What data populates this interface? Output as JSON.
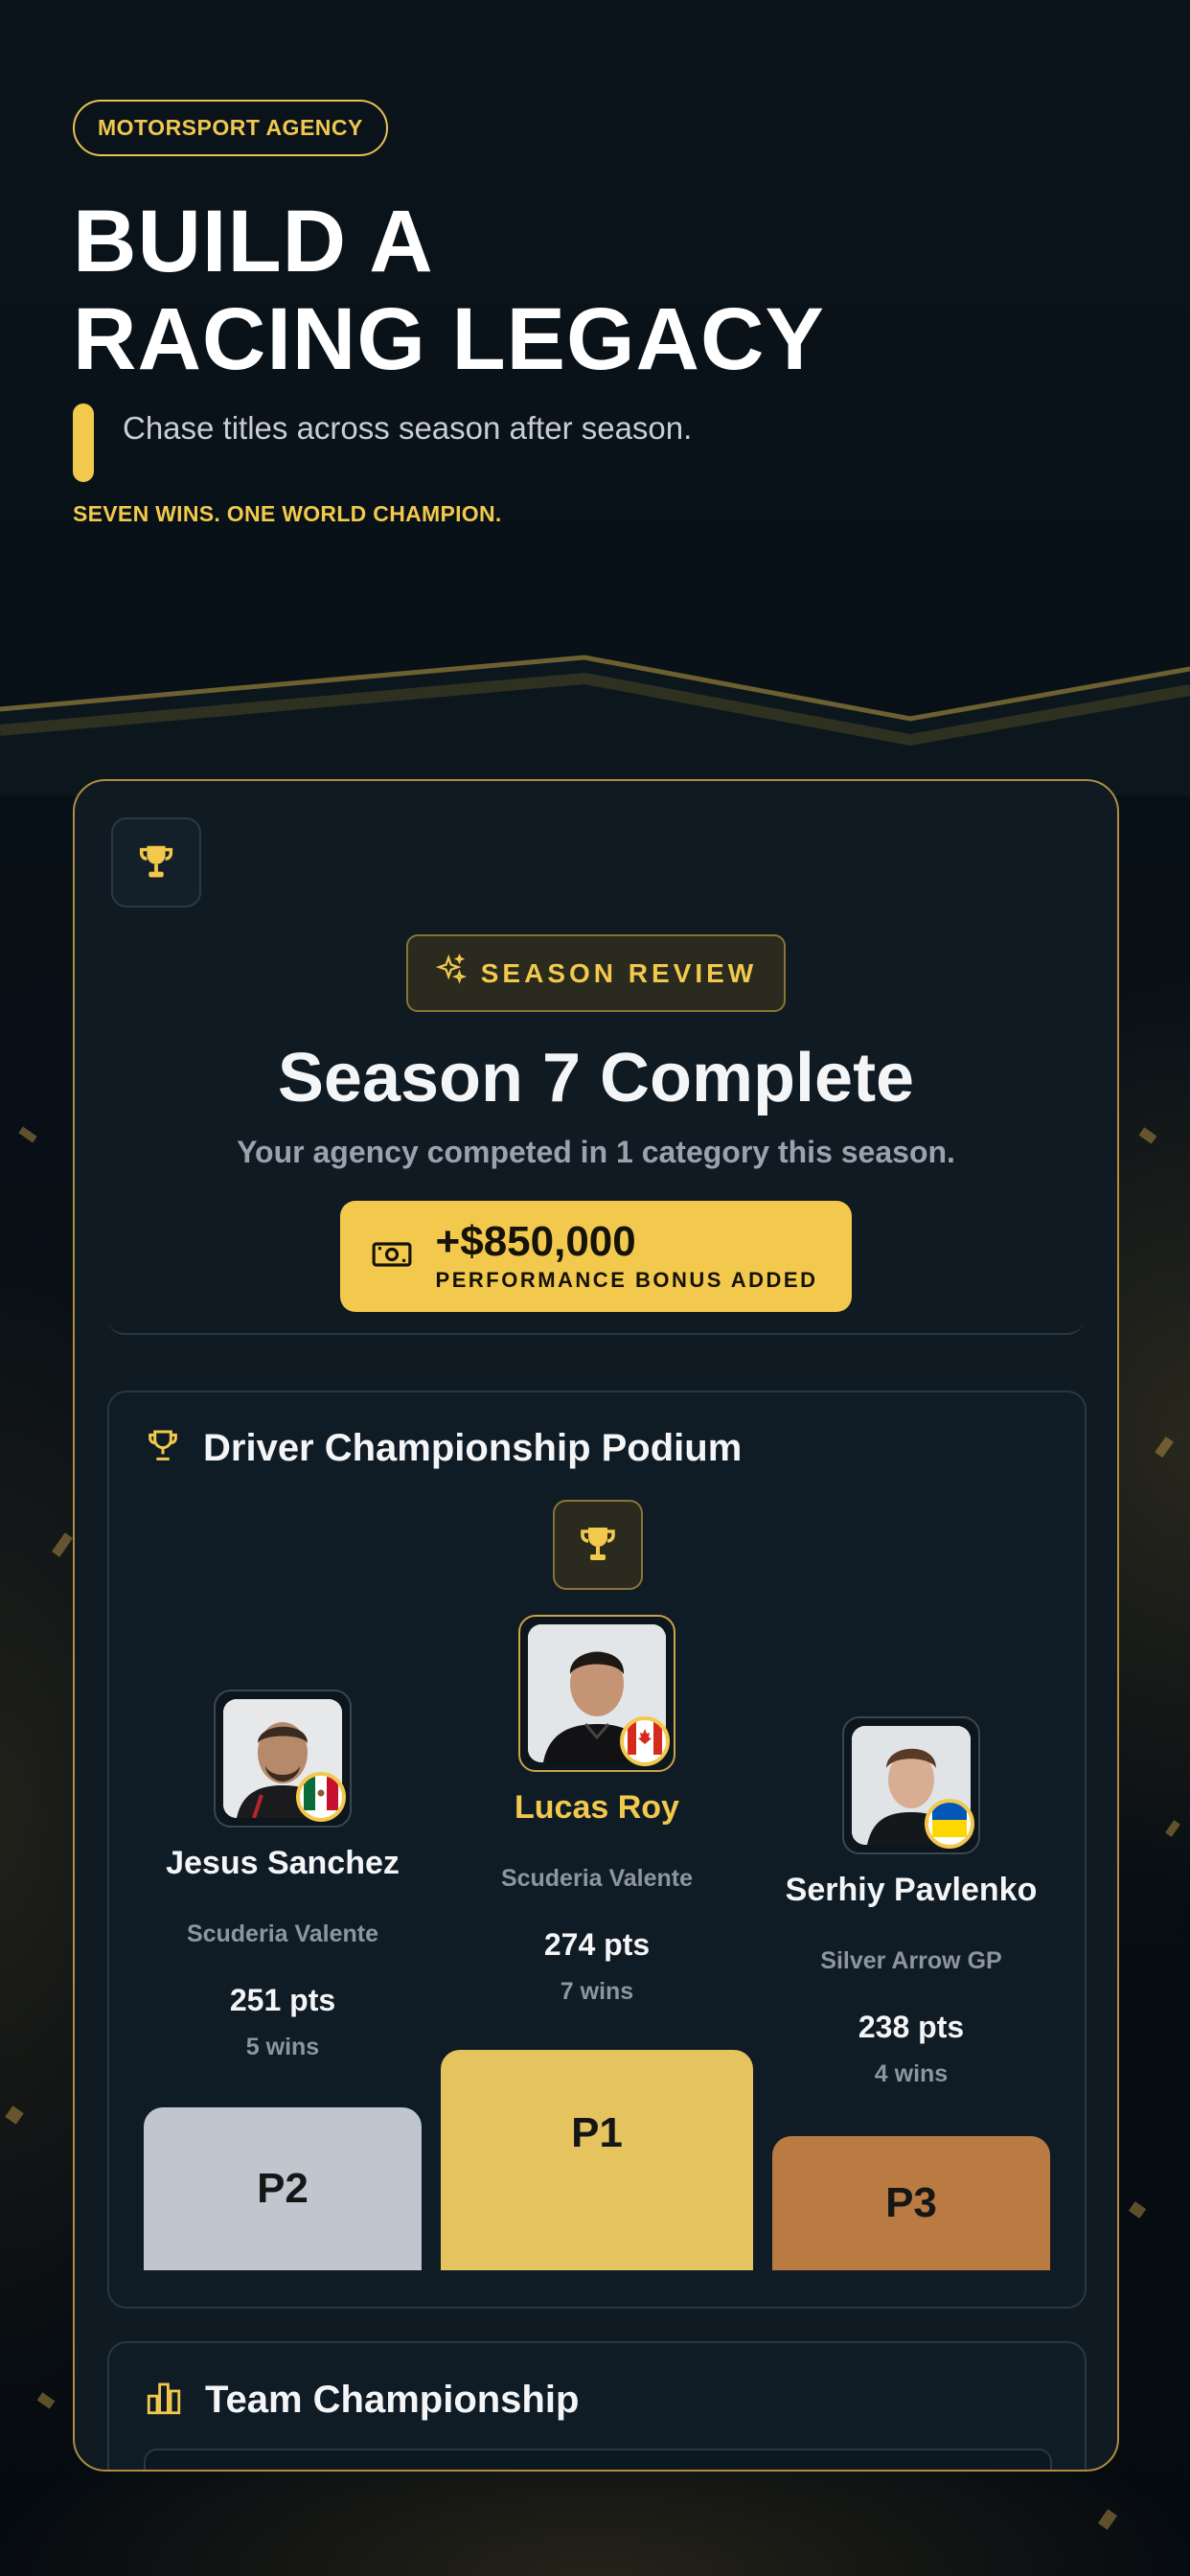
{
  "hero": {
    "tag": "MOTORSPORT AGENCY",
    "title_line1": "BUILD A",
    "title_line2": "RACING LEGACY",
    "subtitle": "Chase titles across season after season.",
    "tagline": "SEVEN WINS. ONE WORLD CHAMPION."
  },
  "season": {
    "icon": "trophy-icon",
    "pill_label": "SEASON REVIEW",
    "pill_icon": "sparkles-icon",
    "title": "Season 7 Complete",
    "subtitle": "Your agency competed in 1 category this season.",
    "bonus": {
      "icon": "cash-icon",
      "amount": "+$850,000",
      "label": "PERFORMANCE BONUS ADDED"
    }
  },
  "podium": {
    "title": "Driver Championship Podium",
    "drivers": [
      {
        "position": "P2",
        "name": "Jesus Sanchez",
        "team": "Scuderia Valente",
        "points": "251 pts",
        "wins": "5 wins",
        "flag": "Mexico"
      },
      {
        "position": "P1",
        "name": "Lucas Roy",
        "team": "Scuderia Valente",
        "points": "274 pts",
        "wins": "7 wins",
        "flag": "Canada"
      },
      {
        "position": "P3",
        "name": "Serhiy Pavlenko",
        "team": "Silver Arrow GP",
        "points": "238 pts",
        "wins": "4 wins",
        "flag": "Ukraine"
      }
    ]
  },
  "team": {
    "title": "Team Championship",
    "icon": "bar-chart-icon"
  },
  "colors": {
    "accent": "#f2c94c",
    "p2": "#bfc6ce",
    "p1": "#e5c35f",
    "p3": "#b97b42"
  }
}
